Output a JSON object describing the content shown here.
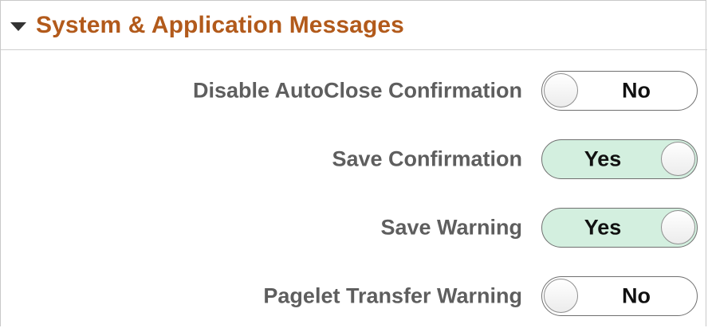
{
  "section": {
    "title": "System & Application Messages",
    "expanded_icon": "triangle-down-icon"
  },
  "settings": [
    {
      "label": "Disable AutoClose Confirmation",
      "value": "No",
      "on": false
    },
    {
      "label": "Save Confirmation",
      "value": "Yes",
      "on": true
    },
    {
      "label": "Save Warning",
      "value": "Yes",
      "on": true
    },
    {
      "label": "Pagelet Transfer Warning",
      "value": "No",
      "on": false
    }
  ],
  "colors": {
    "title": "#b25a1b",
    "label": "#5e5e5e",
    "toggle_on_bg": "#d3efdf",
    "toggle_off_bg": "#ffffff"
  }
}
